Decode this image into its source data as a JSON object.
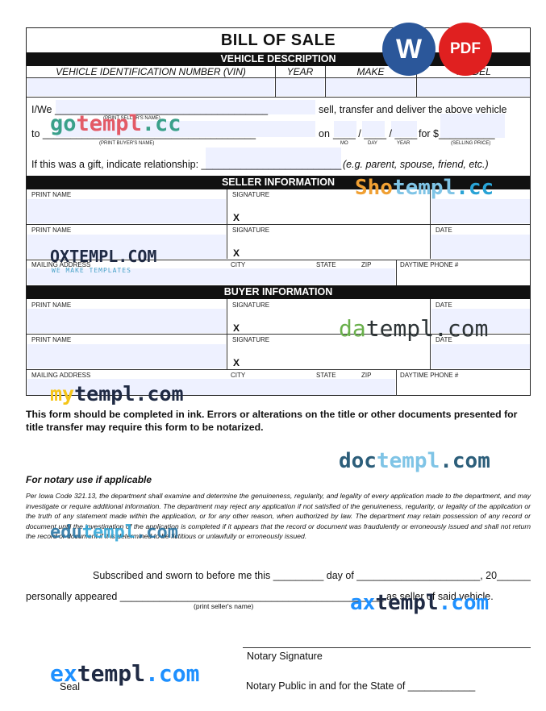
{
  "form": {
    "title": "BILL OF SALE",
    "vehicle_header": "VEHICLE DESCRIPTION",
    "columns": [
      "VEHICLE IDENTIFICATION NUMBER (VIN)",
      "YEAR",
      "MAKE",
      "MODEL"
    ],
    "line1_prefix": "I/We ______________________________________",
    "line1_suffix": "sell, transfer and deliver the above vehicle",
    "print_sellers_name_small": "(PRINT SELLER'S NAME)",
    "line2_prefix": "to ______________________________________",
    "line2_on": "on",
    "date_blanks": "____ / ____ / ____",
    "line2_for": "for $__________",
    "print_buyers_name_small": "(PRINT BUYER'S NAME)",
    "mo": "MO",
    "day": "DAY",
    "year": "YEAR",
    "selling_price": "(SELLING PRICE)",
    "gift_line": "If this was a gift, indicate relationship: _________________________",
    "gift_example": "(e.g. parent, spouse, friend, etc.)",
    "seller_header": "SELLER INFORMATION",
    "buyer_header": "BUYER INFORMATION",
    "print_name": "PRINT NAME",
    "signature": "SIGNATURE",
    "date": "DATE",
    "x_mark": "X",
    "mailing_address": "MAILING ADDRESS",
    "city": "CITY",
    "state": "STATE",
    "zip": "ZIP",
    "daytime_phone": "DAYTIME PHONE #"
  },
  "notice": "This form should be completed in ink.  Errors or alterations on the title or other documents presented for title transfer may require this form to be notarized.",
  "notary": {
    "heading": "For notary use if applicable",
    "paragraph": "Per Iowa Code 321.13, the department shall examine and determine the genuineness, regularity, and legality of every application made to the department, and may investigate or require additional information. The department may reject any application if not satisfied of the genuineness, regularity, or legality of the application or the truth of any statement made within the application, or for any other reason, when authorized by law. The department may retain possession of any record or document until the investigation of the application is completed if it appears that the record or document was fraudulently or erroneously issued and shall not return the record or document if it is determined to be fictitious or unlawfully or erroneously issued.",
    "sworn_line": "Subscribed and sworn to before me this _________ day of ______________________, 20______",
    "appeared_line": "personally appeared _______________________________________________ as seller of said vehicle.",
    "print_sellers_name": "(print seller's name)",
    "notary_signature": "Notary Signature",
    "seal": "Seal",
    "notary_public": "Notary Public in and for the State of ____________"
  },
  "badges": {
    "word": "W",
    "pdf": "PDF",
    "word_color": "#2b579a",
    "pdf_color": "#e02020"
  },
  "watermarks": {
    "gotempl": [
      "go",
      "templ",
      ".cc"
    ],
    "shotempl": [
      "Sho",
      "templ",
      ".cc"
    ],
    "oxtempl": "OXTEMPL.COM",
    "oxtempl_sub": "WE MAKE TEMPLATES",
    "datempl": [
      "da",
      "templ",
      ".com"
    ],
    "mytempl": [
      "my",
      "templ",
      ".com"
    ],
    "doctempl": [
      "doc",
      "templ",
      ".com"
    ],
    "edutempl": [
      "edu",
      "templ",
      ".com"
    ],
    "axtempl": [
      "ax",
      "templ",
      ".com"
    ],
    "extempl": [
      "ex",
      "templ",
      ".com"
    ]
  }
}
